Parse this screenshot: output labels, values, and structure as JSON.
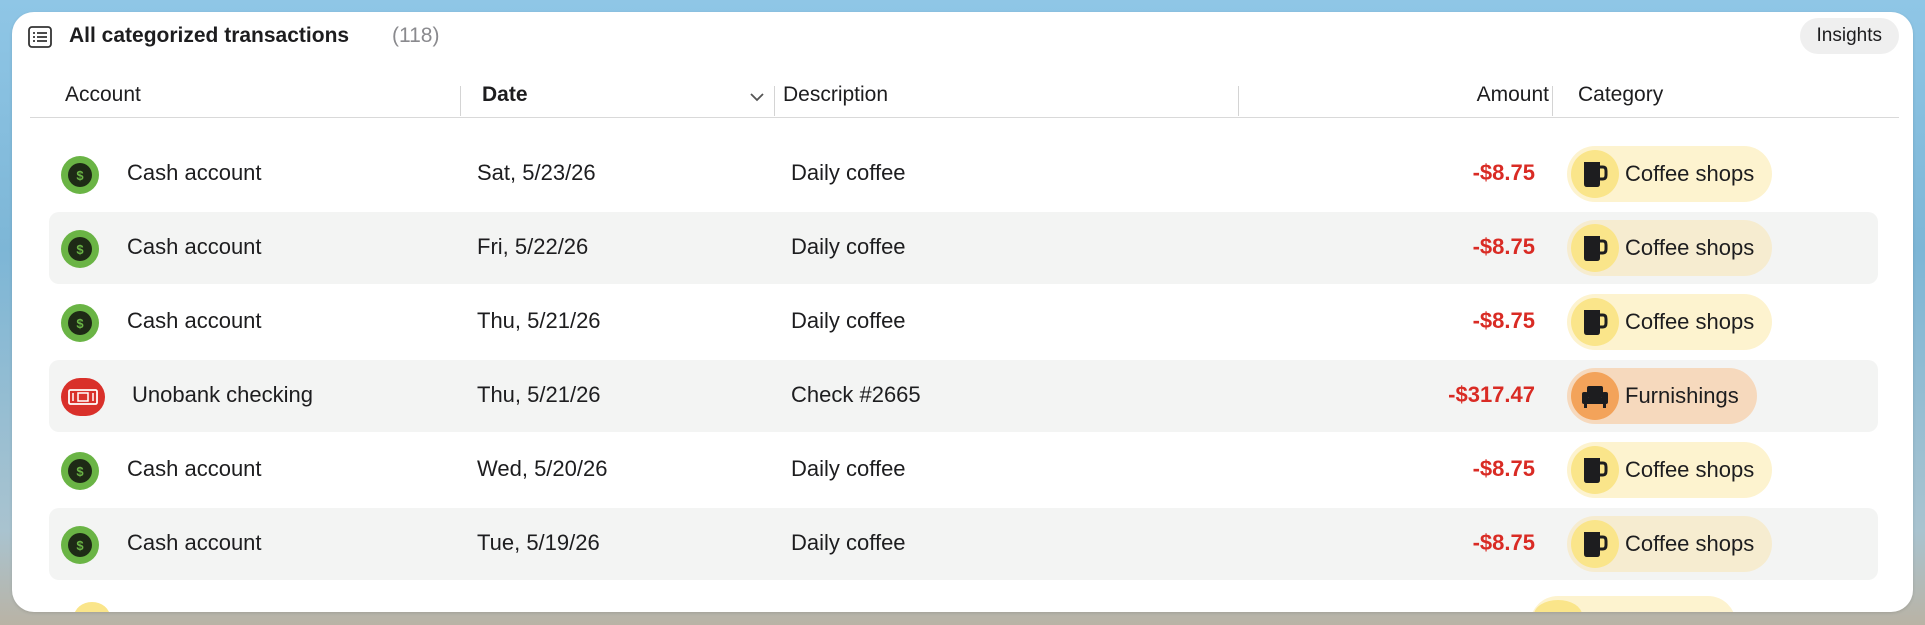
{
  "header": {
    "title": "All categorized transactions",
    "count": "(118)",
    "insights_label": "Insights",
    "title_icon": "list-icon"
  },
  "columns": {
    "account": "Account",
    "date": "Date",
    "description": "Description",
    "amount": "Amount",
    "category": "Category",
    "sort_icon": "chevron-down-icon"
  },
  "colors": {
    "negative_amount": "#d92b24",
    "cash_icon": "#6ab445",
    "bank_icon": "#d9302a",
    "coffee_pill": "#fdf3cf",
    "furnishings_pill": "#f6d9bd"
  },
  "rows": [
    {
      "account": "Cash account",
      "account_icon": "cash-icon",
      "date": "Sat, 5/23/26",
      "description": "Daily coffee",
      "amount": "-$8.75",
      "category": "Coffee shops",
      "category_icon": "coffee-mug-icon"
    },
    {
      "account": "Cash account",
      "account_icon": "cash-icon",
      "date": "Fri, 5/22/26",
      "description": "Daily coffee",
      "amount": "-$8.75",
      "category": "Coffee shops",
      "category_icon": "coffee-mug-icon"
    },
    {
      "account": "Cash account",
      "account_icon": "cash-icon",
      "date": "Thu, 5/21/26",
      "description": "Daily coffee",
      "amount": "-$8.75",
      "category": "Coffee shops",
      "category_icon": "coffee-mug-icon"
    },
    {
      "account": "Unobank checking",
      "account_icon": "bank-check-icon",
      "date": "Thu, 5/21/26",
      "description": "Check #2665",
      "amount": "-$317.47",
      "category": "Furnishings",
      "category_icon": "armchair-icon"
    },
    {
      "account": "Cash account",
      "account_icon": "cash-icon",
      "date": "Wed, 5/20/26",
      "description": "Daily coffee",
      "amount": "-$8.75",
      "category": "Coffee shops",
      "category_icon": "coffee-mug-icon"
    },
    {
      "account": "Cash account",
      "account_icon": "cash-icon",
      "date": "Tue, 5/19/26",
      "description": "Daily coffee",
      "amount": "-$8.75",
      "category": "Coffee shops",
      "category_icon": "coffee-mug-icon"
    }
  ]
}
